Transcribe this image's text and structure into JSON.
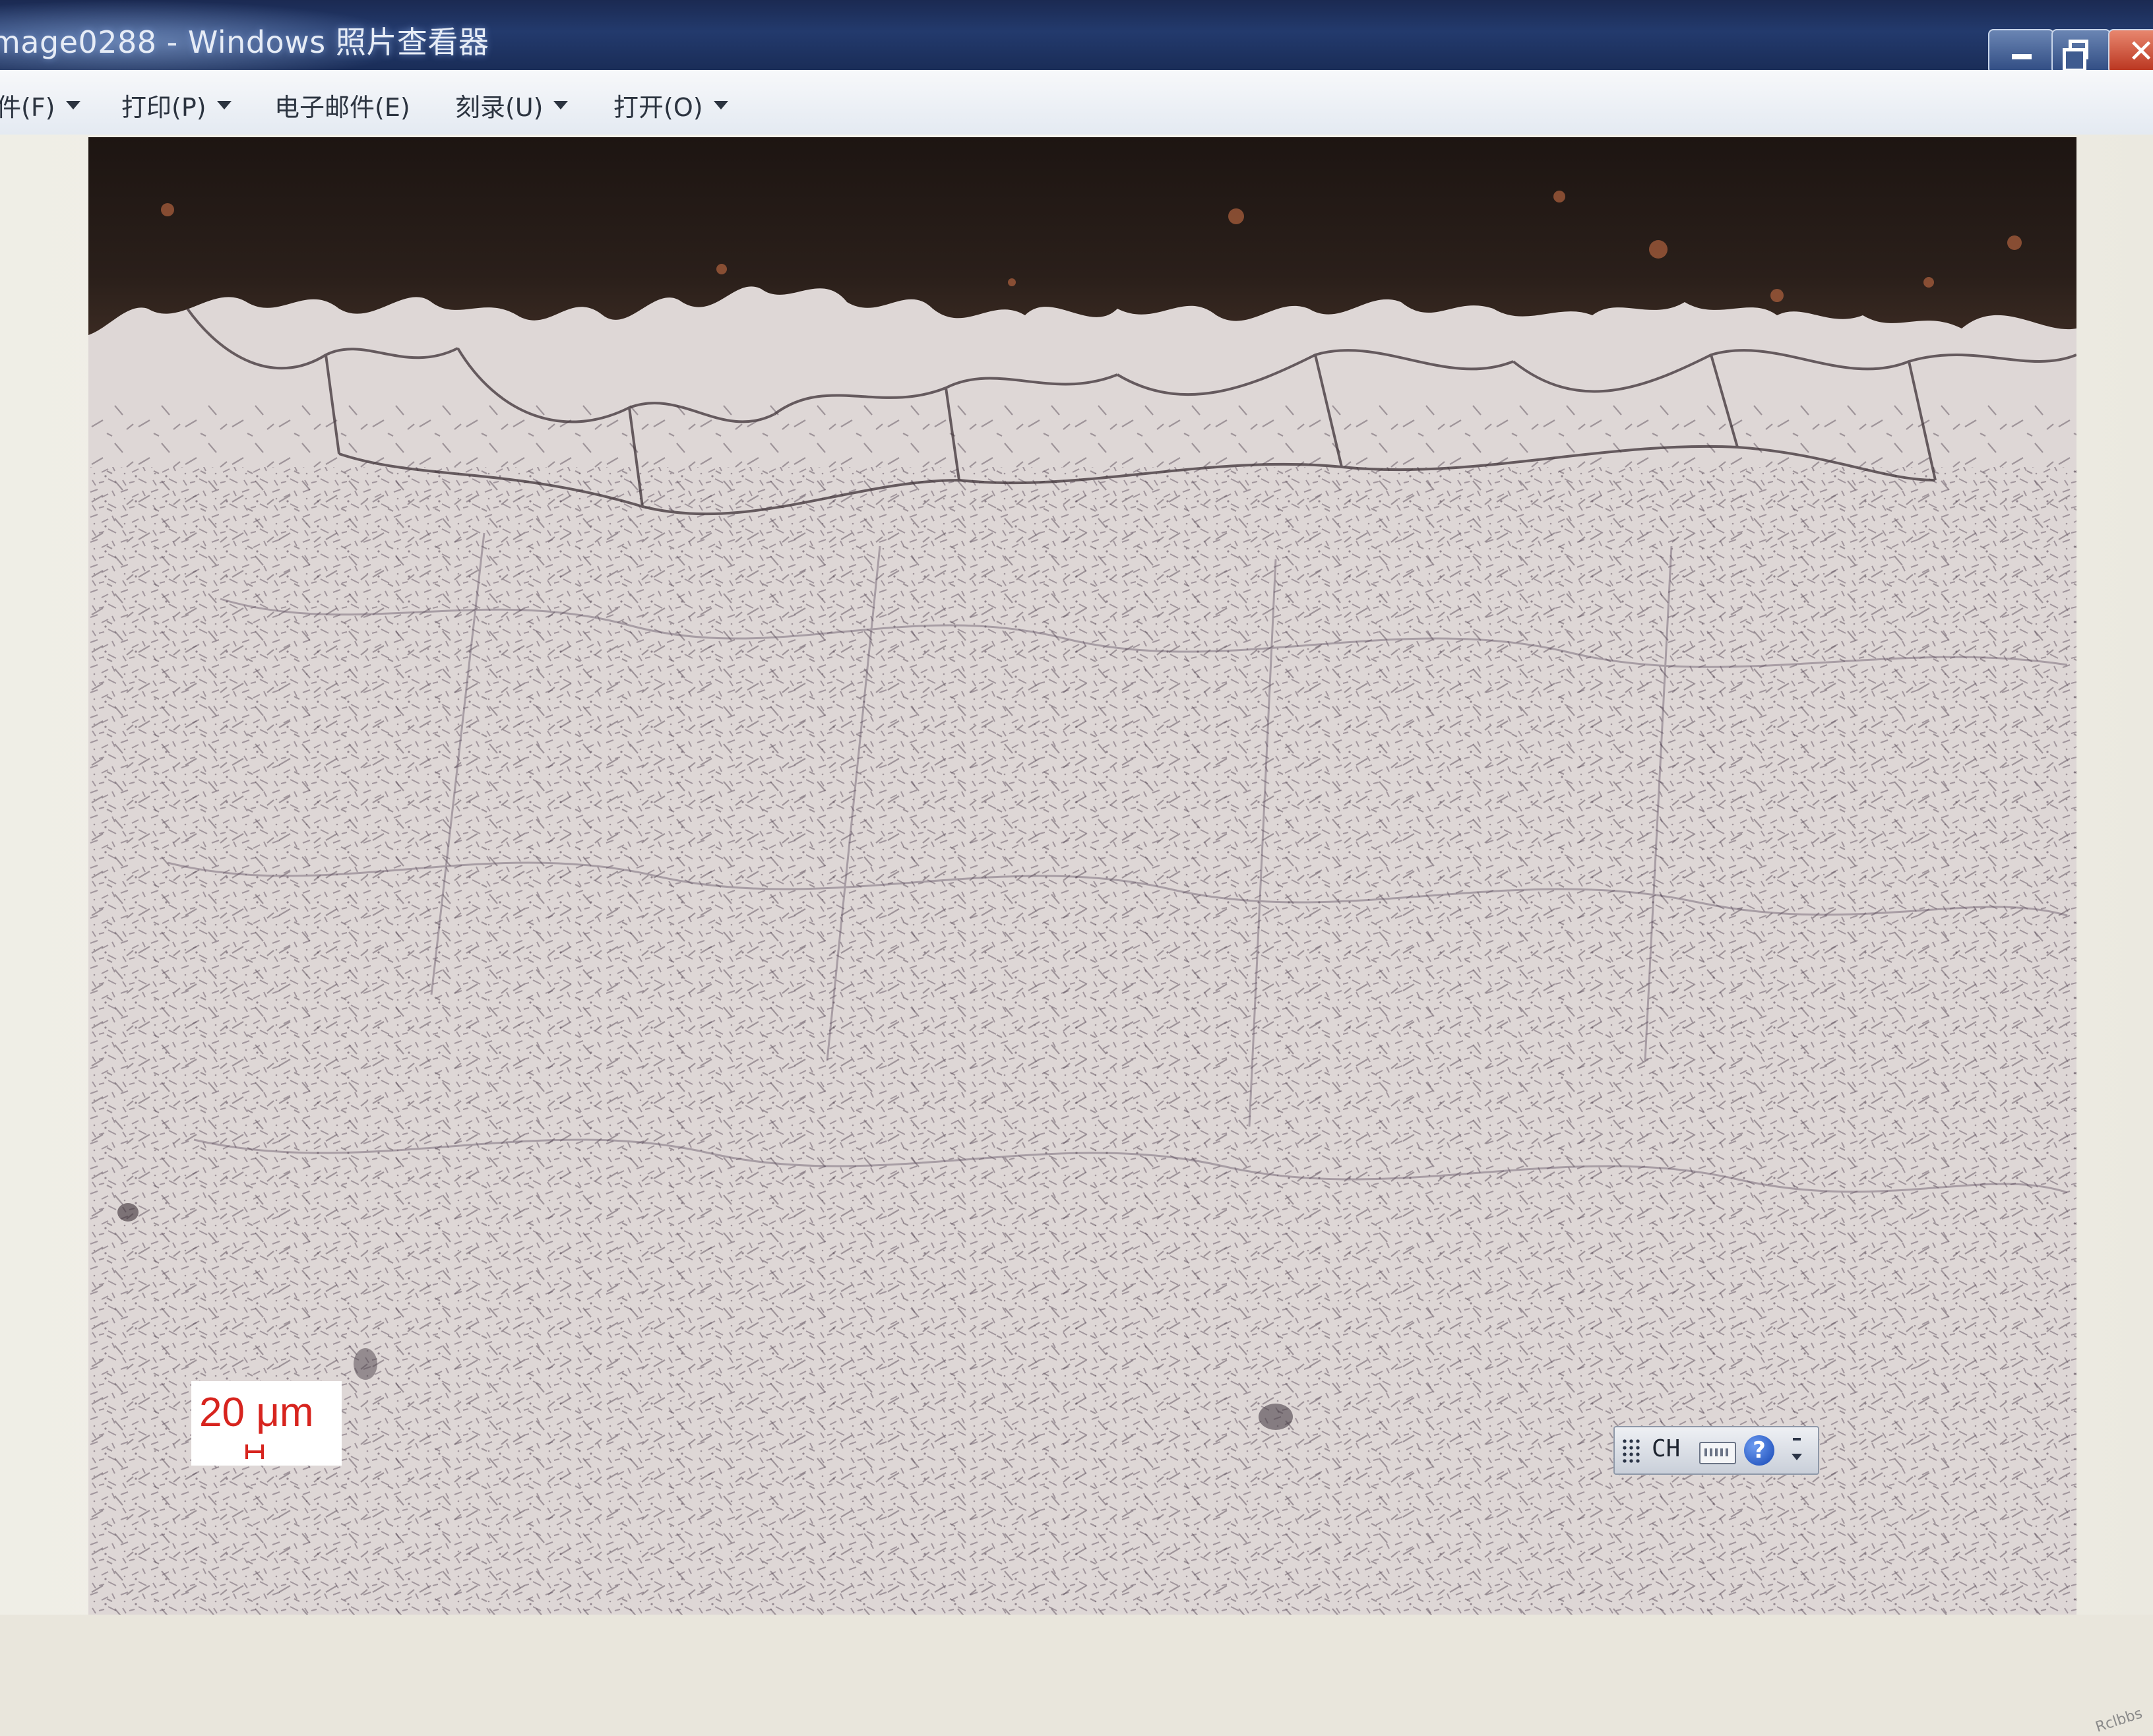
{
  "window": {
    "title": "mage0288 - Windows 照片查看器"
  },
  "menu": {
    "items": [
      {
        "label": "件(F)",
        "has_dropdown": true
      },
      {
        "label": "打印(P)",
        "has_dropdown": true
      },
      {
        "label": "电子邮件(E)",
        "has_dropdown": false
      },
      {
        "label": "刻录(U)",
        "has_dropdown": true
      },
      {
        "label": "打开(O)",
        "has_dropdown": true
      }
    ]
  },
  "image": {
    "scale_label": "20 μm"
  },
  "language_bar": {
    "language": "CH",
    "help_label": "?"
  },
  "watermark": "Rclbbs",
  "colors": {
    "titlebar": "#233a6d",
    "menubar": "#eef1f5",
    "scale_label": "#d7241e",
    "close_button": "#c0392b"
  }
}
